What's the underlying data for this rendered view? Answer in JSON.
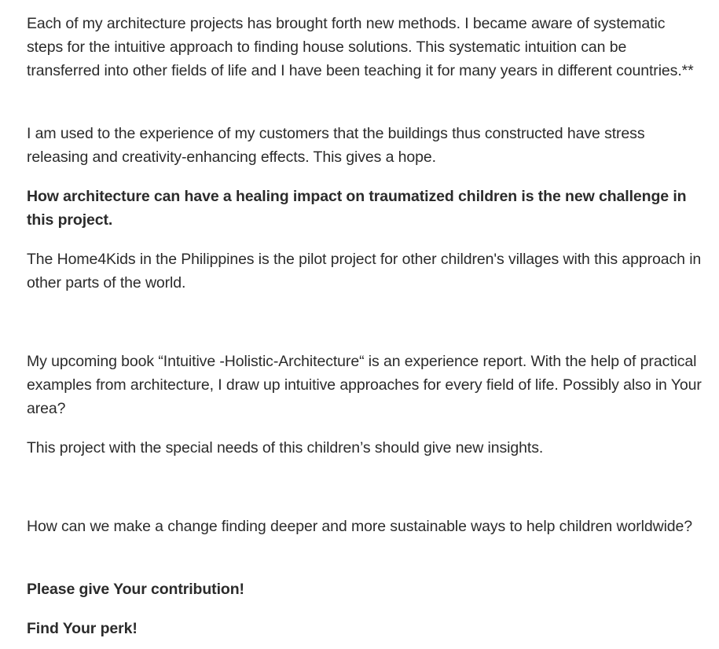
{
  "article": {
    "p1": "Each of my architecture projects has brought forth new methods. I became aware of systematic steps for the intuitive approach to finding house solutions. This systematic intuition can be transferred into other fields of life and I have been teaching it for many years in different countries.**",
    "p2": "I am used to the experience of my customers that the buildings thus constructed have stress releasing and creativity-enhancing effects. This gives a hope.",
    "p3": "How architecture can have a healing impact on traumatized children is the new challenge in this project.",
    "p4": "The Home4Kids in the Philippines is the pilot project for other children's villages with this approach in other parts of the world.",
    "p5": "My upcoming book “Intuitive -Holistic-Architecture“ is an experience report. With the help of practical examples from architecture, I draw up intuitive approaches for every field of life. Possibly also in Your area?",
    "p6": "This project with the special needs of this children’s should give new insights.",
    "p7": "How can we make a change finding deeper and more sustainable ways to help children worldwide?",
    "p8": "Please give Your contribution!",
    "p9": "Find Your perk!"
  }
}
